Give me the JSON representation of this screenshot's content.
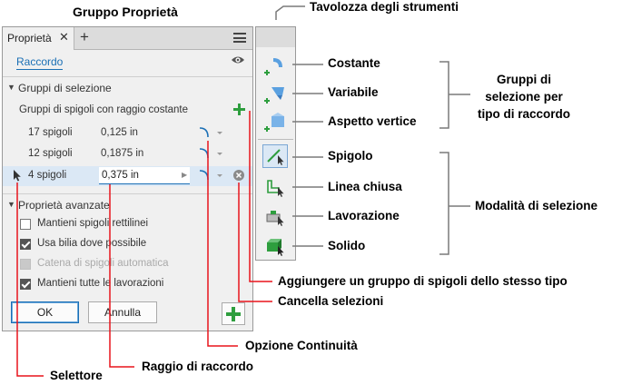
{
  "callouts": {
    "gruppo_proprieta": "Gruppo Proprietà",
    "tavolozza": "Tavolozza degli strumenti",
    "costante": "Costante",
    "variabile": "Variabile",
    "aspetto_vertice": "Aspetto vertice",
    "gruppi_selezione_tipo": "Gruppi di\nselezione per\ntipo di raccordo",
    "spigolo": "Spigolo",
    "linea_chiusa": "Linea chiusa",
    "lavorazione": "Lavorazione",
    "solido": "Solido",
    "modalita_selezione": "Modalità di selezione",
    "aggiungere_gruppo": "Aggiungere un gruppo di spigoli dello stesso tipo",
    "cancella_selezioni": "Cancella selezioni",
    "opzione_continuita": "Opzione Continuità",
    "raggio_raccordo": "Raggio di raccordo",
    "selettore": "Selettore"
  },
  "panel": {
    "tab_label": "Proprietà",
    "feature_link": "Raccordo",
    "section_selection": "Gruppi di selezione",
    "group_header": "Gruppi di spigoli con raggio costante",
    "rows": [
      {
        "edges": "17 spigoli",
        "radius": "0,125 in"
      },
      {
        "edges": "12 spigoli",
        "radius": "0,1875 in"
      },
      {
        "edges": "4 spigoli",
        "radius": "0,375 in"
      }
    ],
    "section_advanced": "Proprietà avanzate",
    "options": [
      {
        "label": "Mantieni spigoli rettilinei",
        "state": "unchecked"
      },
      {
        "label": "Usa bilia dove possibile",
        "state": "checked"
      },
      {
        "label": "Catena di spigoli automatica",
        "state": "disabled"
      },
      {
        "label": "Mantieni tutte le lavorazioni",
        "state": "checked"
      }
    ],
    "ok_label": "OK",
    "cancel_label": "Annulla"
  },
  "colors": {
    "accent": "#1a6fb5",
    "add_green": "#2e9e3e",
    "callout_red": "#e8141c",
    "bracket_gray": "#7a7a7a"
  }
}
